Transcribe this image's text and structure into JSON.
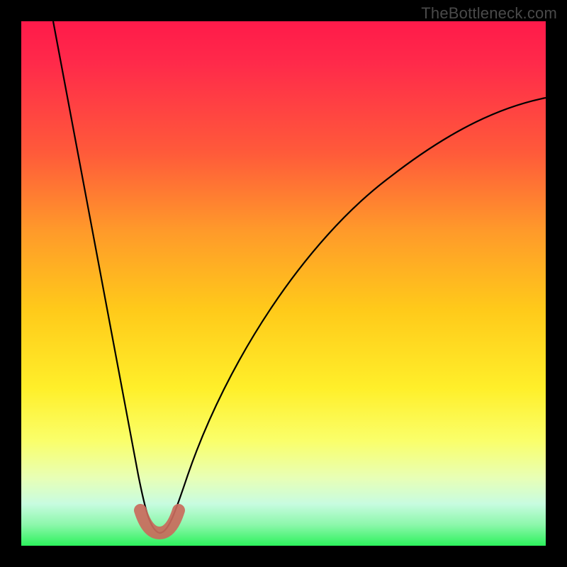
{
  "watermark": "TheBottleneck.com",
  "chart_data": {
    "type": "line",
    "title": "",
    "xlabel": "",
    "ylabel": "",
    "xlim": [
      0,
      100
    ],
    "ylim": [
      0,
      100
    ],
    "series": [
      {
        "name": "bottleneck-curve",
        "x": [
          0,
          2,
          4,
          6,
          8,
          10,
          12,
          14,
          16,
          18,
          20,
          22,
          23,
          24,
          25,
          26,
          27,
          28,
          30,
          33,
          36,
          40,
          45,
          50,
          55,
          60,
          65,
          70,
          75,
          80,
          85,
          90,
          95,
          100
        ],
        "values": [
          100,
          93,
          86,
          79,
          72,
          65,
          58,
          50,
          41,
          31,
          19,
          8,
          4,
          1,
          0,
          0,
          1,
          3,
          8,
          15,
          22,
          31,
          41,
          49,
          56,
          62,
          67,
          71,
          75,
          78,
          80,
          82,
          83,
          84
        ]
      }
    ],
    "highlighted_region": {
      "description": "bottom-of-curve marker",
      "x": [
        22,
        23.5,
        25,
        26.5,
        28
      ],
      "values": [
        4,
        1,
        0,
        1,
        4
      ]
    }
  }
}
